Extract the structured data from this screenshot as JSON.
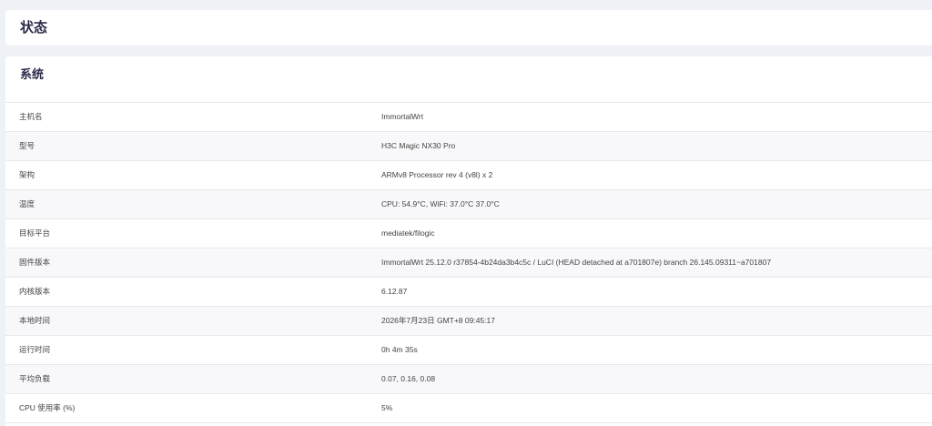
{
  "status_panel": {
    "title": "状态"
  },
  "system_panel": {
    "title": "系统",
    "rows": [
      {
        "label": "主机名",
        "value": "ImmortalWrt"
      },
      {
        "label": "型号",
        "value": "H3C Magic NX30 Pro"
      },
      {
        "label": "架构",
        "value": "ARMv8 Processor rev 4 (v8l) x 2"
      },
      {
        "label": "温度",
        "value": "CPU: 54.9°C, WiFi: 37.0°C 37.0°C"
      },
      {
        "label": "目标平台",
        "value": "mediatek/filogic"
      },
      {
        "label": "固件版本",
        "value": "ImmortalWrt 25.12.0 r37854-4b24da3b4c5c / LuCI (HEAD detached at a701807e) branch 26.145.09311~a701807"
      },
      {
        "label": "内核版本",
        "value": "6.12.87"
      },
      {
        "label": "本地时间",
        "value": "2026年7月23日 GMT+8 09:45:17"
      },
      {
        "label": "运行时间",
        "value": "0h 4m 35s"
      },
      {
        "label": "平均负载",
        "value": "0.07, 0.16, 0.08"
      },
      {
        "label": "CPU 使用率 (%)",
        "value": "5%"
      }
    ]
  }
}
